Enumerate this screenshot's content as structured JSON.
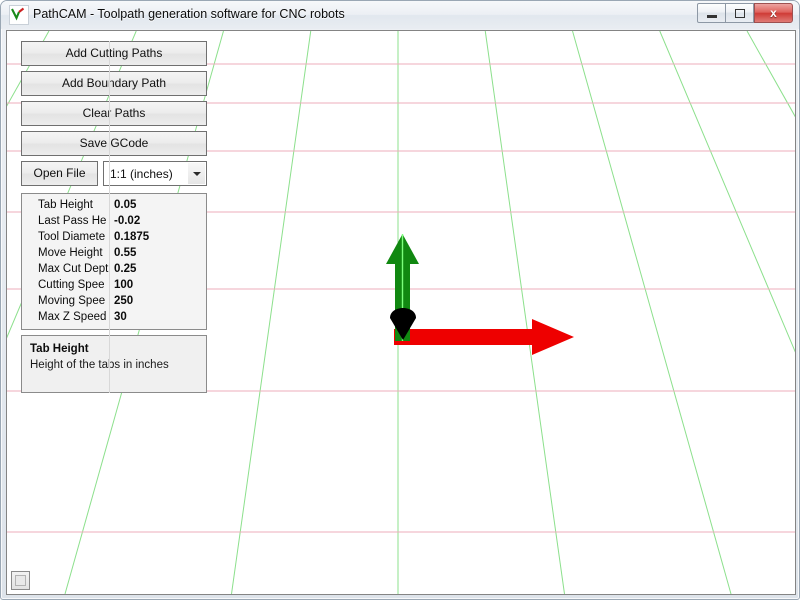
{
  "window": {
    "title": "PathCAM - Toolpath generation software for CNC robots",
    "app_icon": "checkmark-icon",
    "controls": {
      "minimize": "minimize-icon",
      "maximize": "maximize-icon",
      "close_label": "x"
    }
  },
  "toolbar": {
    "buttons": [
      {
        "label": "Add Cutting Paths"
      },
      {
        "label": "Add Boundary Path"
      },
      {
        "label": "Clear Paths"
      },
      {
        "label": "Save GCode"
      }
    ],
    "open_file_label": "Open File",
    "unit_combo": {
      "value": "1:1 (inches)",
      "options": [
        "1:1 (inches)"
      ]
    }
  },
  "properties": {
    "rows": [
      {
        "label": "Tab Height",
        "value": "0.05"
      },
      {
        "label": "Last Pass He",
        "value": "-0.02"
      },
      {
        "label": "Tool Diamete",
        "value": "0.1875"
      },
      {
        "label": "Move Height",
        "value": "0.55"
      },
      {
        "label": "Max Cut Dept",
        "value": "0.25"
      },
      {
        "label": "Cutting Spee",
        "value": "100"
      },
      {
        "label": "Moving Spee",
        "value": "250"
      },
      {
        "label": "Max Z Speed",
        "value": "30"
      }
    ]
  },
  "description": {
    "title": "Tab Height",
    "body": "Height of the tabs in inches"
  },
  "viewport": {
    "background_color": "#ffffff",
    "grid_line_color": "#8ce08c",
    "row_line_color": "#eeaebb",
    "axes": {
      "x_axis": {
        "name": "x-axis-arrow",
        "color": "#ee0000",
        "direction": "right"
      },
      "y_axis": {
        "name": "y-axis-arrow",
        "color": "#118811",
        "direction": "up"
      },
      "z_axis": {
        "name": "z-axis-arrow",
        "color": "#000000",
        "direction": "toward-viewer"
      }
    }
  },
  "corner_button": {
    "name": "resize-grip-button"
  }
}
